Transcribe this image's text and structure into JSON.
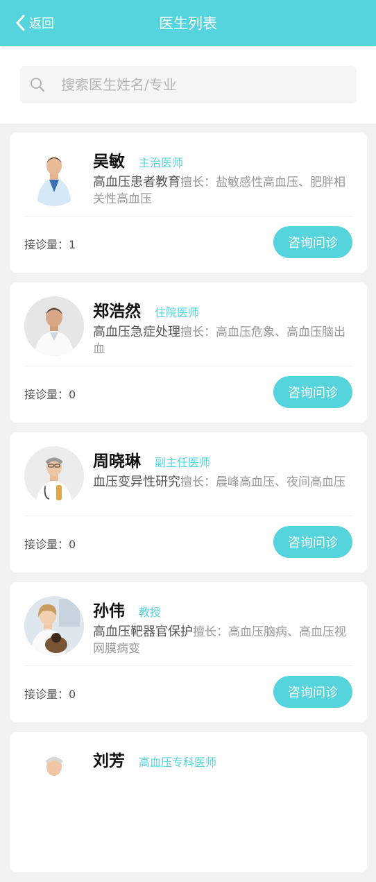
{
  "header": {
    "back_label": "返回",
    "title": "医生列表"
  },
  "search": {
    "placeholder": "搜索医生姓名/专业"
  },
  "doctors": [
    {
      "name": "吴敏",
      "rank": "主治医师",
      "specialty": "高血压患者教育",
      "expertise": "擅长：盐敏感性高血压、肥胖相关性高血压",
      "consult_count": "接诊量：1",
      "button": "咨询问诊"
    },
    {
      "name": "郑浩然",
      "rank": "住院医师",
      "specialty": "高血压急症处理",
      "expertise": "擅长：高血压危象、高血压脑出血",
      "consult_count": "接诊量：0",
      "button": "咨询问诊"
    },
    {
      "name": "周晓琳",
      "rank": "副主任医师",
      "specialty": "血压变异性研究",
      "expertise": "擅长：晨峰高血压、夜间高血压",
      "consult_count": "接诊量：0",
      "button": "咨询问诊"
    },
    {
      "name": "孙伟",
      "rank": "教授",
      "specialty": "高血压靶器官保护",
      "expertise": "擅长：高血压脑病、高血压视网膜病变",
      "consult_count": "接诊量：0",
      "button": "咨询问诊"
    },
    {
      "name": "刘芳",
      "rank": "高血压专科医师",
      "specialty": "",
      "expertise": "",
      "consult_count": "",
      "button": ""
    }
  ],
  "colors": {
    "accent": "#56d4dd",
    "background": "#f2f2f2"
  }
}
